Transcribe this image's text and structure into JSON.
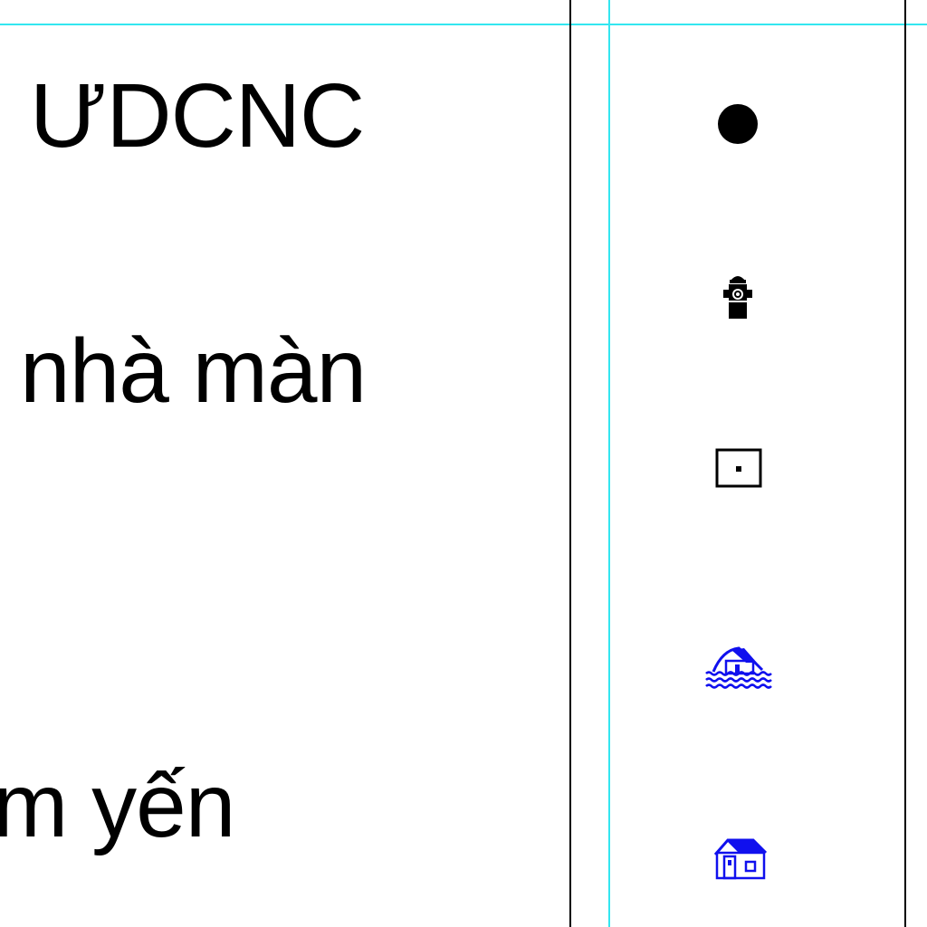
{
  "legend_rows": [
    {
      "label": "ƯDCNC",
      "symbol": "filled-circle-icon"
    },
    {
      "label": "nhà màn",
      "symbol": "fire-hydrant-icon"
    },
    {
      "label": "",
      "symbol": "square-with-dot-icon"
    },
    {
      "label": "",
      "symbol": "house-on-water-icon"
    },
    {
      "label": "m yến",
      "symbol": "house-icon"
    }
  ],
  "colors": {
    "guide_line": "#33e6f0",
    "text": "#000000",
    "symbol_black": "#000000",
    "symbol_blue": "#1010ee"
  }
}
